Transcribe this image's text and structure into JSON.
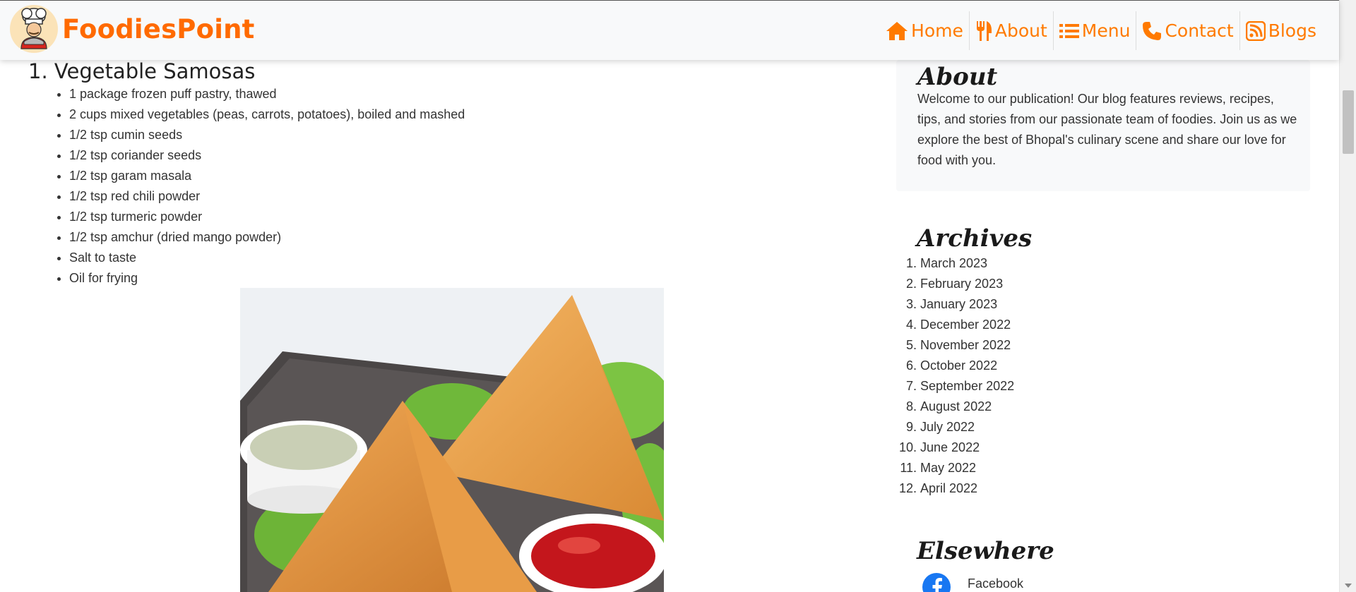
{
  "header": {
    "brand": "FoodiesPoint",
    "logo_icon": "chef-logo-icon",
    "nav": [
      {
        "label": "Home",
        "icon": "home-icon"
      },
      {
        "label": "About",
        "icon": "utensils-icon"
      },
      {
        "label": "Menu",
        "icon": "list-icon"
      },
      {
        "label": "Contact",
        "icon": "phone-icon"
      },
      {
        "label": "Blogs",
        "icon": "rss-icon"
      }
    ],
    "accent_color": "#ff6a00"
  },
  "recipe": {
    "title": "1. Vegetable Samosas",
    "ingredients": [
      "1 package frozen puff pastry, thawed",
      "2 cups mixed vegetables (peas, carrots, potatoes), boiled and mashed",
      "1/2 tsp cumin seeds",
      "1/2 tsp coriander seeds",
      "1/2 tsp garam masala",
      "1/2 tsp red chili powder",
      "1/2 tsp turmeric powder",
      "1/2 tsp amchur (dried mango powder)",
      "Salt to taste",
      "Oil for frying"
    ]
  },
  "sidebar": {
    "about": {
      "title": "About",
      "text": "Welcome to our publication! Our blog features reviews, recipes, tips, and stories from our passionate team of foodies. Join us as we explore the best of Bhopal's culinary scene and share our love for food with you."
    },
    "archives": {
      "title": "Archives",
      "items": [
        {
          "num": "1.",
          "label": "March 2023"
        },
        {
          "num": "2.",
          "label": "February 2023"
        },
        {
          "num": "3.",
          "label": "January 2023"
        },
        {
          "num": "4.",
          "label": "December 2022"
        },
        {
          "num": "5.",
          "label": "November 2022"
        },
        {
          "num": "6.",
          "label": "October 2022"
        },
        {
          "num": "7.",
          "label": "September 2022"
        },
        {
          "num": "8.",
          "label": "August 2022"
        },
        {
          "num": "9.",
          "label": "July 2022"
        },
        {
          "num": "10.",
          "label": "June 2022"
        },
        {
          "num": "11.",
          "label": "May 2022"
        },
        {
          "num": "12.",
          "label": "April 2022"
        }
      ]
    },
    "elsewhere": {
      "title": "Elsewhere",
      "links": [
        {
          "label": "Facebook",
          "icon": "facebook-icon"
        }
      ]
    }
  }
}
